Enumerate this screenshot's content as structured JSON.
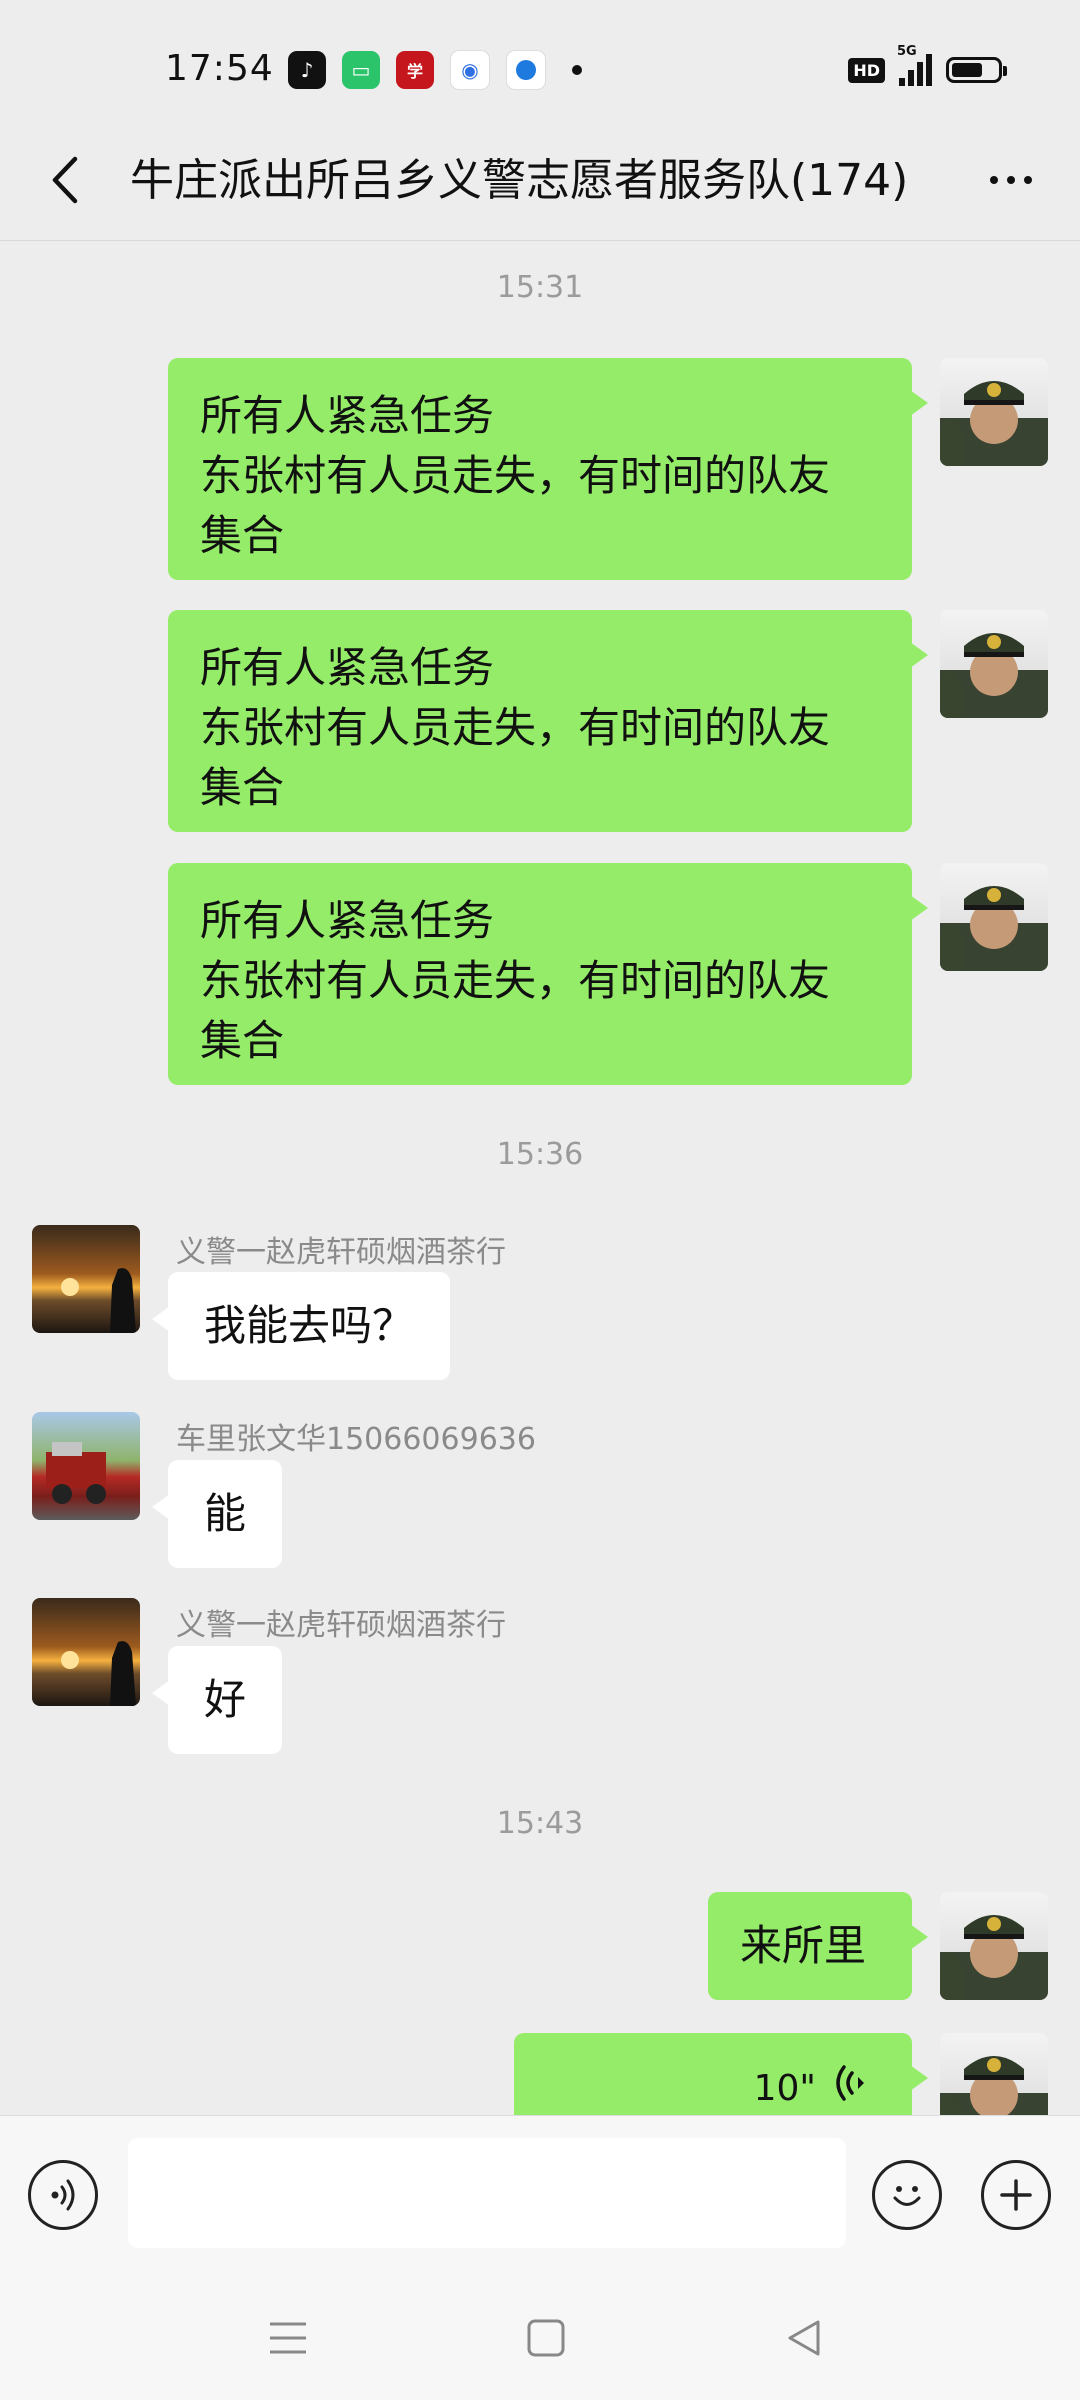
{
  "status_bar": {
    "time": "17:54",
    "apps": [
      "tiktok-icon",
      "chat-bubble-icon",
      "xuexi-icon",
      "baidu-icon",
      "circle-app-icon"
    ],
    "hd_label": "HD",
    "network_label": "5G",
    "battery_level": 0.6
  },
  "header": {
    "title": "牛庄派出所吕乡义警志愿者服务队(174)"
  },
  "messages": {
    "ts1": "15:31",
    "m1": {
      "line1": "所有人紧急任务",
      "line2": "东张村有人员走失，有时间的队友",
      "line3": "集合"
    },
    "m2": {
      "line1": "所有人紧急任务",
      "line2": "东张村有人员走失，有时间的队友",
      "line3": "集合"
    },
    "m3": {
      "line1": "所有人紧急任务",
      "line2": "东张村有人员走失，有时间的队友",
      "line3": "集合"
    },
    "ts2": "15:36",
    "m4": {
      "sender": "义警一赵虎轩硕烟酒茶行",
      "text": "我能去吗？"
    },
    "m5": {
      "sender": "车里张文华15066069636",
      "text": "能"
    },
    "m6": {
      "sender": "义警一赵虎轩硕烟酒茶行",
      "text": "好"
    },
    "ts3": "15:43",
    "m7": {
      "text": "来所里"
    },
    "m8": {
      "duration": "10\""
    }
  },
  "input": {
    "placeholder": ""
  },
  "colors": {
    "my_bubble": "#95ec69",
    "their_bubble": "#ffffff",
    "background": "#ededed"
  }
}
